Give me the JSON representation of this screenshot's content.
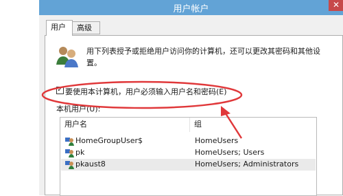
{
  "window": {
    "title": "用户帐户",
    "close_glyph": "✕"
  },
  "tabs": [
    {
      "label": "用户",
      "active": true
    },
    {
      "label": "高级",
      "active": false
    }
  ],
  "users_tab": {
    "description": "用下列表授予或拒绝用户访问你的计算机，还可以更改其密码和其他设置。",
    "require_login_checkbox": {
      "label": "要使用本计算机，用户必须输入用户名和密码(E)",
      "checked": true,
      "check_glyph": "✓"
    },
    "local_users_label": "本机用户(U):",
    "columns": [
      "用户名",
      "组"
    ],
    "users": [
      {
        "name": "HomeGroupUser$",
        "group": "HomeUsers",
        "selected": false
      },
      {
        "name": "pk",
        "group": "HomeUsers; Users",
        "selected": false
      },
      {
        "name": "pkaust8",
        "group": "HomeUsers; Administrators",
        "selected": true
      }
    ]
  },
  "colors": {
    "titlebar": "#62a3d6",
    "close_button": "#c7494a",
    "annotation": "#e0383a"
  },
  "icons": {
    "users": "users-icon",
    "user_row": "user-account-icon",
    "close": "close-icon"
  }
}
